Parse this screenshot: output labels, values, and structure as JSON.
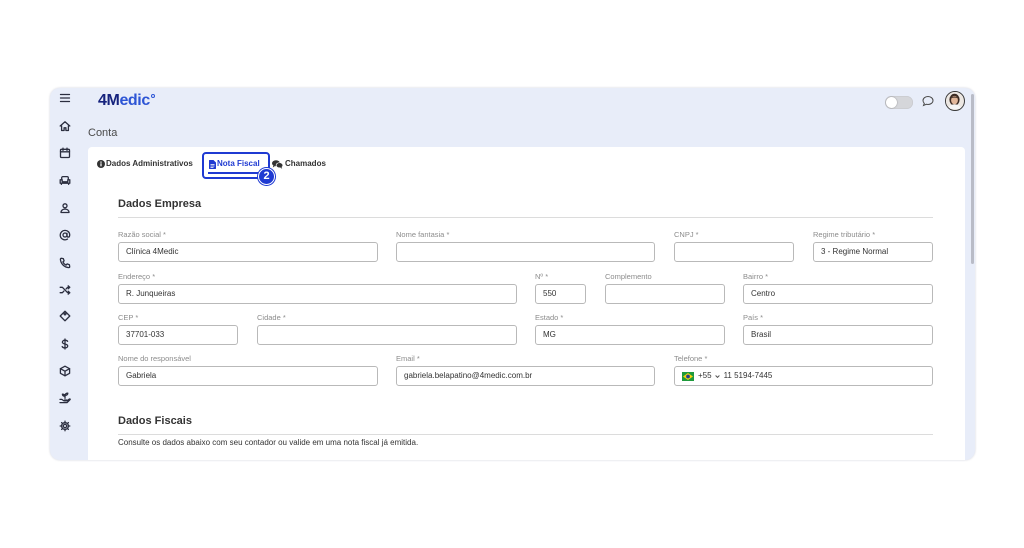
{
  "colors": {
    "frame_bg": "#e8edf9",
    "brand_navy": "#16237d",
    "brand_blue": "#2d55d5",
    "accent": "#1f3ad2",
    "icon": "#2b2e3f"
  },
  "brand": {
    "logo_bold": "4M",
    "logo_rest": "edic"
  },
  "sidebar": {
    "icons": [
      "menu-icon",
      "home-icon",
      "calendar-icon",
      "sofa-icon",
      "user-icon",
      "at-icon",
      "phone-icon",
      "shuffle-icon",
      "tag-icon",
      "dollar-icon",
      "box-icon",
      "hand-plant-icon",
      "gear-icon"
    ]
  },
  "topbar": {
    "theme_toggle": {
      "on": false
    },
    "chat_icon": "chat-icon",
    "avatar_icon": "user-avatar"
  },
  "page": {
    "title": "Conta"
  },
  "tabs": [
    {
      "label": "Dados Administrativos",
      "icon": "info-icon",
      "active": false
    },
    {
      "label": "Nota Fiscal",
      "icon": "file-icon",
      "active": true
    },
    {
      "label": "Chamados",
      "icon": "comments-icon",
      "active": false
    }
  ],
  "annotation": {
    "step": "2"
  },
  "empresa": {
    "title": "Dados Empresa",
    "fields": {
      "razao_social": {
        "label": "Razão social *",
        "value": "Clínica 4Medic"
      },
      "nome_fantasia": {
        "label": "Nome fantasia *",
        "value": ""
      },
      "cnpj": {
        "label": "CNPJ *",
        "value": ""
      },
      "regime": {
        "label": "Regime tributário *",
        "value": "3 - Regime Normal"
      },
      "endereco": {
        "label": "Endereço *",
        "value": "R. Junqueiras"
      },
      "numero": {
        "label": "Nº *",
        "value": "550"
      },
      "complemento": {
        "label": "Complemento",
        "value": ""
      },
      "bairro": {
        "label": "Bairro *",
        "value": "Centro"
      },
      "cep": {
        "label": "CEP *",
        "value": "37701-033"
      },
      "cidade": {
        "label": "Cidade *",
        "value": ""
      },
      "estado": {
        "label": "Estado *",
        "value": "MG"
      },
      "pais": {
        "label": "País *",
        "value": "Brasil"
      },
      "responsavel": {
        "label": "Nome do responsável",
        "value": "Gabriela"
      },
      "email": {
        "label": "Email *",
        "value": "gabriela.belapatino@4medic.com.br"
      },
      "telefone": {
        "label": "Telefone *",
        "country_flag": "brazil-flag-icon",
        "country_code": "+55",
        "value": "11 5194-7445"
      }
    }
  },
  "fiscais": {
    "title": "Dados Fiscais",
    "note": "Consulte os dados abaixo com seu contador ou valide em uma nota fiscal já emitida."
  }
}
